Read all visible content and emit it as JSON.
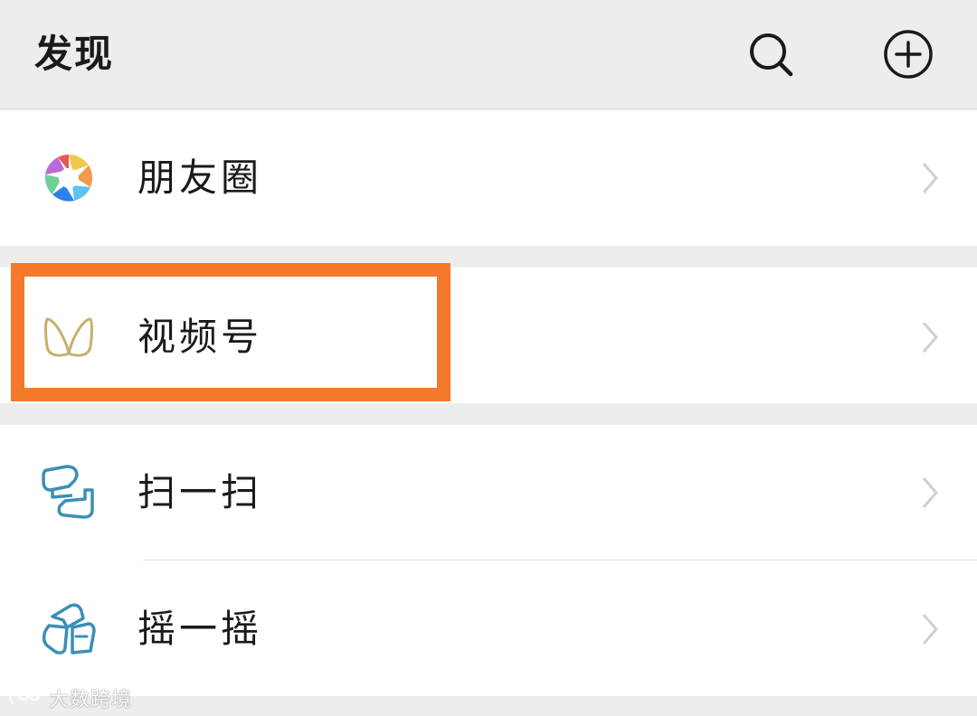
{
  "header": {
    "title": "发现",
    "search_icon": "search-icon",
    "add_icon": "plus-circle-icon"
  },
  "menu": {
    "items": [
      {
        "label": "朋友圈",
        "icon": "moments-aperture-icon"
      },
      {
        "label": "视频号",
        "icon": "channels-butterfly-icon",
        "highlighted": true
      },
      {
        "label": "扫一扫",
        "icon": "scan-icon"
      },
      {
        "label": "摇一摇",
        "icon": "shake-icon"
      }
    ]
  },
  "highlight": {
    "color": "#f5792a"
  },
  "watermark": {
    "text": "大数跨境"
  },
  "colors": {
    "background": "#ededed",
    "cell": "#ffffff",
    "text": "#1a1a1a",
    "icon_teal": "#3a8fb7",
    "channels_gold": "#c7b06a"
  }
}
